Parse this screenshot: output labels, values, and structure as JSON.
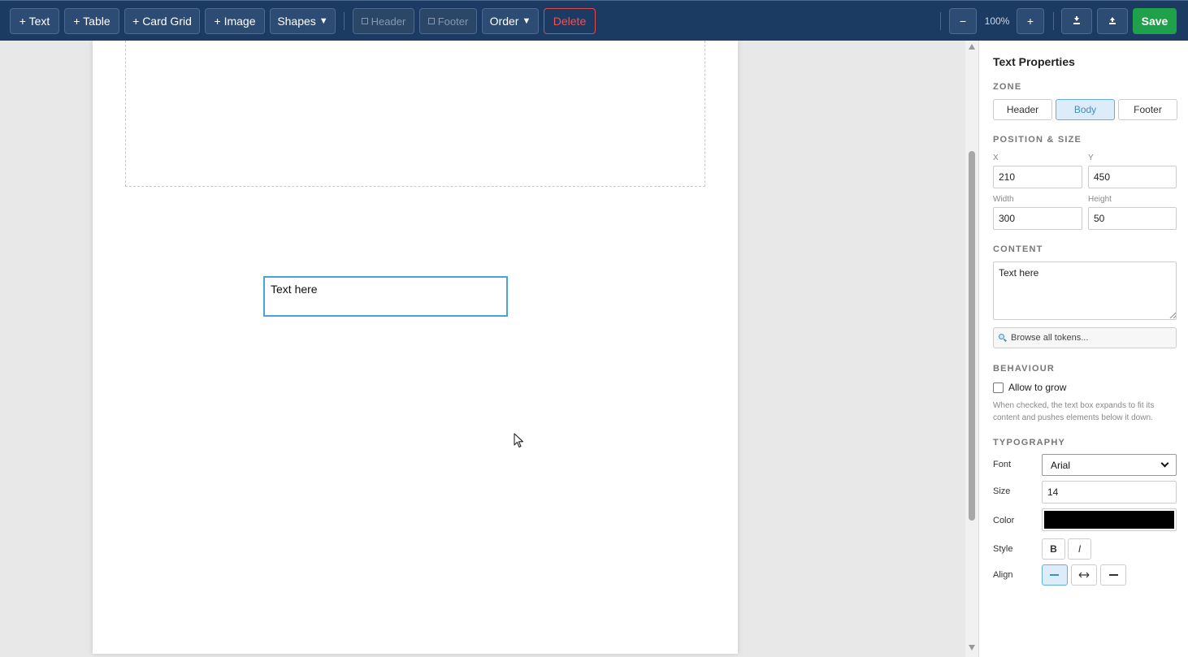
{
  "toolbar": {
    "add_text": "+ Text",
    "add_table": "+ Table",
    "add_card_grid": "+ Card Grid",
    "add_image": "+ Image",
    "shapes": "Shapes",
    "header": "Header",
    "footer": "Footer",
    "order": "Order",
    "delete": "Delete",
    "zoom_out": "−",
    "zoom_level": "100%",
    "zoom_in": "+",
    "save": "Save"
  },
  "canvas": {
    "selected_text": "Text here"
  },
  "panel": {
    "title": "Text Properties",
    "zone": {
      "label": "ZONE",
      "options": [
        "Header",
        "Body",
        "Footer"
      ],
      "selected": "Body"
    },
    "position": {
      "label": "POSITION & SIZE",
      "x_label": "X",
      "x": "210",
      "y_label": "Y",
      "y": "450",
      "width_label": "Width",
      "width": "300",
      "height_label": "Height",
      "height": "50"
    },
    "content": {
      "label": "CONTENT",
      "value": "Text here",
      "browse_tokens": "Browse all tokens..."
    },
    "behaviour": {
      "label": "BEHAVIOUR",
      "allow_grow": "Allow to grow",
      "allow_grow_checked": false,
      "hint": "When checked, the text box expands to fit its content and pushes elements below it down."
    },
    "typography": {
      "label": "TYPOGRAPHY",
      "font_label": "Font",
      "font": "Arial",
      "size_label": "Size",
      "size": "14",
      "color_label": "Color",
      "color": "#000000",
      "style_label": "Style",
      "bold": "B",
      "italic": "I",
      "align_label": "Align"
    }
  },
  "colors": {
    "toolbar_bg": "#1c3b63",
    "accent": "#4aa3d8",
    "save": "#1fa04a",
    "delete": "#f05252"
  }
}
